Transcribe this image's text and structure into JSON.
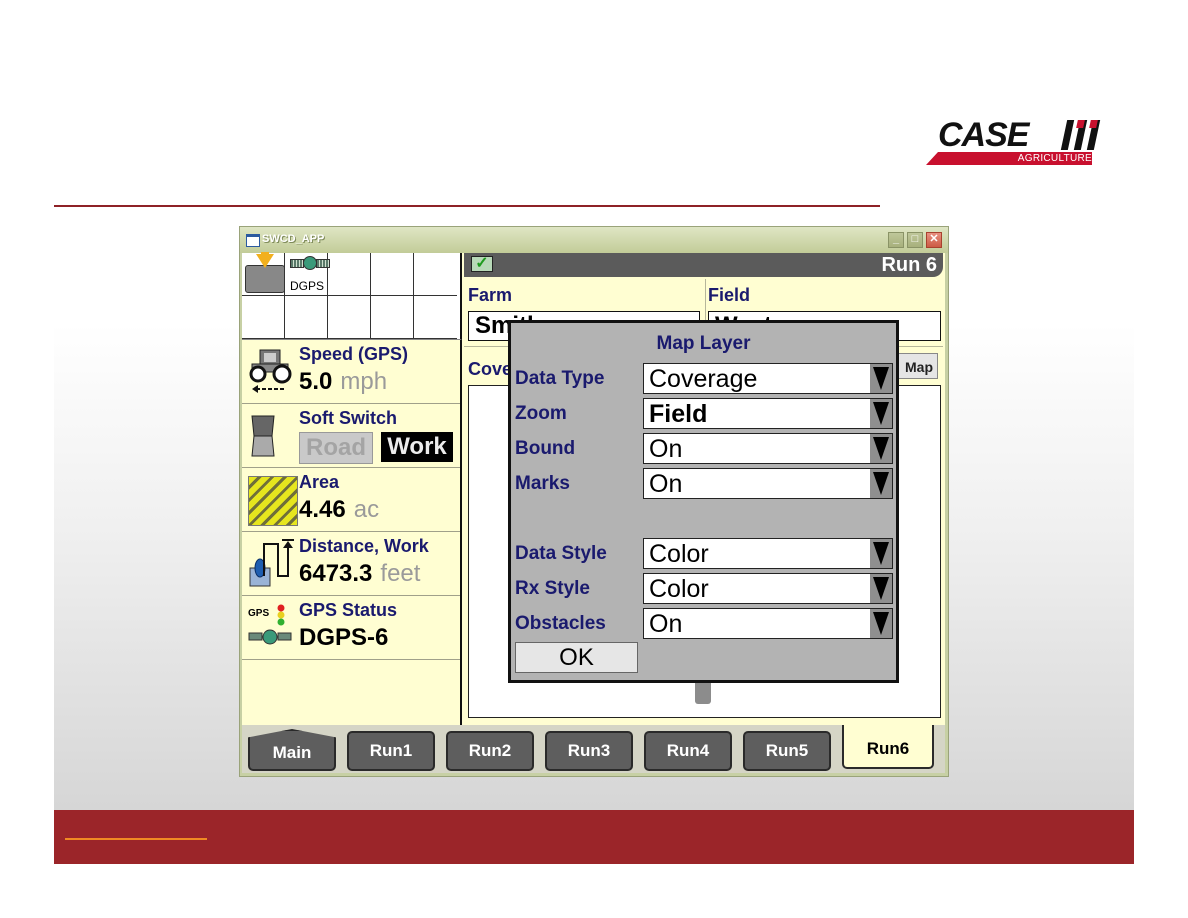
{
  "brand": {
    "name": "CASE",
    "tagline": "AGRICULTURE",
    "colors": {
      "primary_red": "#9b2529",
      "rule_red": "#8e2126",
      "accent_orange": "#f08a24"
    }
  },
  "window": {
    "title": "SWCD_APP",
    "controls": {
      "minimize": "_",
      "maximize": "□",
      "close": "✕"
    }
  },
  "icon_grid": {
    "icons": [
      {
        "name": "data-download-icon"
      },
      {
        "name": "dgps-satellite-icon",
        "label": "DGPS"
      }
    ]
  },
  "status_panel": {
    "speed": {
      "label": "Speed (GPS)",
      "value": "5.0",
      "unit": "mph"
    },
    "soft_switch": {
      "label": "Soft Switch",
      "road": "Road",
      "work": "Work",
      "active": "Work"
    },
    "area": {
      "label": "Area",
      "value": "4.46",
      "unit": "ac"
    },
    "distance": {
      "label": "Distance, Work",
      "value": "6473.3",
      "unit": "feet"
    },
    "gps_status": {
      "label": "GPS Status",
      "gps_tag": "GPS",
      "value": "DGPS-6"
    }
  },
  "run_panel": {
    "title": "Run 6",
    "farm": {
      "label": "Farm",
      "value": "Smith"
    },
    "field": {
      "label": "Field",
      "value": "West"
    },
    "coverage_label": "Coverage",
    "map_layer_button": "Map Layer"
  },
  "tabs": [
    {
      "label": "Main",
      "active": false
    },
    {
      "label": "Run1",
      "active": false
    },
    {
      "label": "Run2",
      "active": false
    },
    {
      "label": "Run3",
      "active": false
    },
    {
      "label": "Run4",
      "active": false
    },
    {
      "label": "Run5",
      "active": false
    },
    {
      "label": "Run6",
      "active": true
    }
  ],
  "dialog": {
    "title": "Map Layer",
    "rows": [
      {
        "label": "Data Type",
        "value": "Coverage"
      },
      {
        "label": "Zoom",
        "value": "Field"
      },
      {
        "label": "Bound",
        "value": "On"
      },
      {
        "label": "Marks",
        "value": "On"
      },
      {
        "label": "Data Style",
        "value": "Color"
      },
      {
        "label": "Rx Style",
        "value": "Color"
      },
      {
        "label": "Obstacles",
        "value": "On"
      }
    ],
    "ok_label": "OK"
  }
}
